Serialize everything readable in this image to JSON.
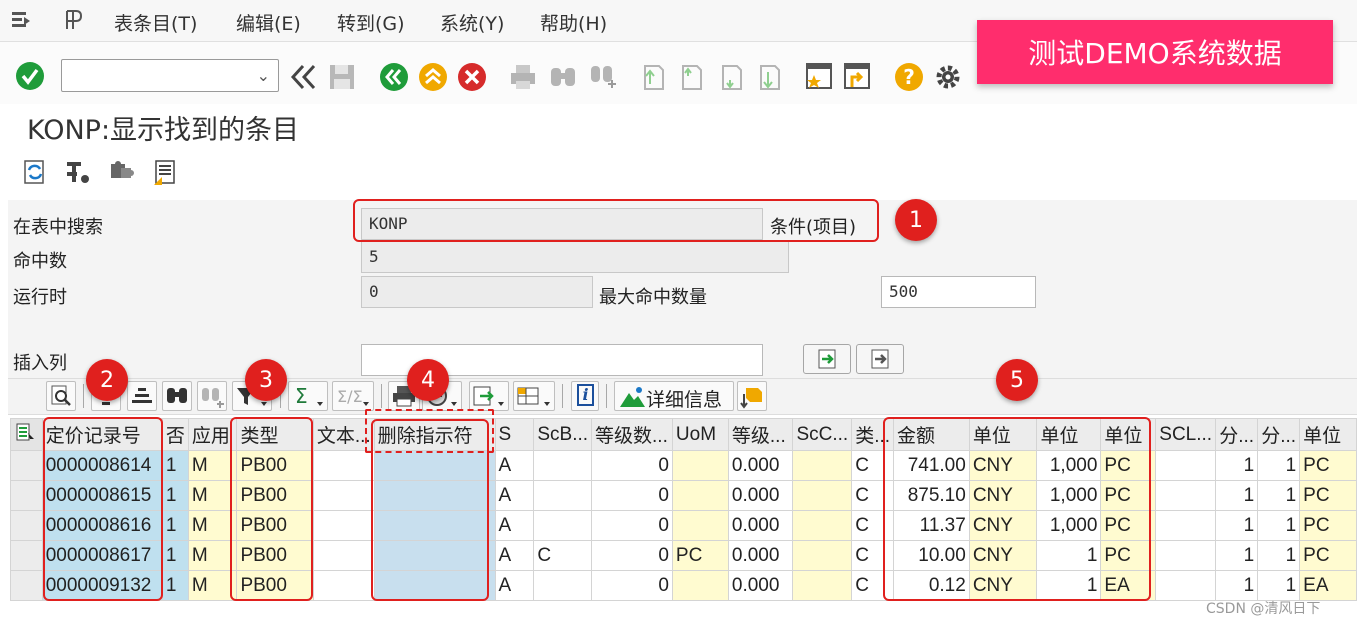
{
  "menu": {
    "items": [
      "表条目(T)",
      "编辑(E)",
      "转到(G)",
      "系统(Y)",
      "帮助(H)"
    ]
  },
  "banner": {
    "text": "测试DEMO系统数据"
  },
  "page": {
    "title": "KONP:显示找到的条目"
  },
  "form": {
    "search_label": "在表中搜索",
    "search_value": "KONP",
    "search_desc": "条件(项目)",
    "hits_label": "命中数",
    "hits_value": "5",
    "runtime_label": "运行时",
    "runtime_value": "0",
    "max_hits_label": "最大命中数量",
    "max_hits_value": "500",
    "insert_col_label": "插入列",
    "insert_col_value": ""
  },
  "alv": {
    "detail_label": "详细信息",
    "info_label": "i",
    "sum_label": "Σ"
  },
  "badges": [
    "1",
    "2",
    "3",
    "4",
    "5"
  ],
  "grid": {
    "headers": [
      "定价记录号",
      "否",
      "应用",
      "类型",
      "文本...",
      "删除指示符",
      "S",
      "ScB...",
      "等级数...",
      "UoM",
      "等级...",
      "ScC...",
      "类...",
      "金额",
      "单位",
      "单位",
      "单位",
      "SCL...",
      "分...",
      "分...",
      "单位"
    ],
    "rows": [
      [
        "0000008614",
        "1",
        "M",
        "PB00",
        "",
        "",
        "A",
        "",
        "0",
        "",
        "0.000",
        "",
        "C",
        "741.00",
        "CNY",
        "1,000",
        "PC",
        "",
        "1",
        "1",
        "PC"
      ],
      [
        "0000008615",
        "1",
        "M",
        "PB00",
        "",
        "",
        "A",
        "",
        "0",
        "",
        "0.000",
        "",
        "C",
        "875.10",
        "CNY",
        "1,000",
        "PC",
        "",
        "1",
        "1",
        "PC"
      ],
      [
        "0000008616",
        "1",
        "M",
        "PB00",
        "",
        "",
        "A",
        "",
        "0",
        "",
        "0.000",
        "",
        "C",
        "11.37",
        "CNY",
        "1,000",
        "PC",
        "",
        "1",
        "1",
        "PC"
      ],
      [
        "0000008617",
        "1",
        "M",
        "PB00",
        "",
        "",
        "A",
        "C",
        "0",
        "PC",
        "0.000",
        "",
        "C",
        "10.00",
        "CNY",
        "1",
        "PC",
        "",
        "1",
        "1",
        "PC"
      ],
      [
        "0000009132",
        "1",
        "M",
        "PB00",
        "",
        "",
        "A",
        "",
        "0",
        "",
        "0.000",
        "",
        "C",
        "0.12",
        "CNY",
        "1",
        "EA",
        "",
        "1",
        "1",
        "EA"
      ]
    ]
  },
  "watermark": "CSDN @清风日下"
}
